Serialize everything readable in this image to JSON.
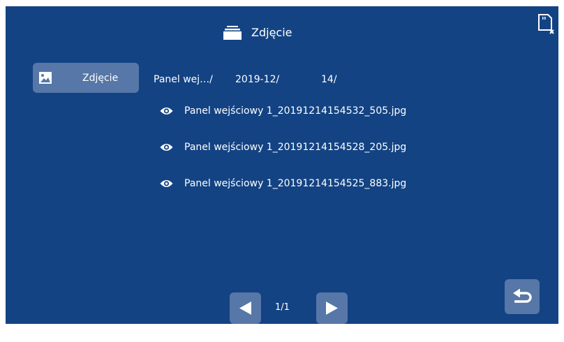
{
  "header": {
    "title": "Zdjęcie",
    "icon": "folder-stack-icon"
  },
  "status": {
    "sd_icon": "sd-card-removed-icon"
  },
  "sidebar": {
    "items": [
      {
        "label": "Zdjęcie",
        "icon": "image-icon",
        "selected": true
      }
    ]
  },
  "breadcrumb": {
    "part1": "Panel wej…/",
    "part2": "2019-12/",
    "part3": "14/"
  },
  "files": [
    {
      "name": "Panel wejściowy 1_20191214154532_505.jpg",
      "icon": "eye-icon"
    },
    {
      "name": "Panel wejściowy 1_20191214154528_205.jpg",
      "icon": "eye-icon"
    },
    {
      "name": "Panel wejściowy 1_20191214154525_883.jpg",
      "icon": "eye-icon"
    }
  ],
  "pager": {
    "indicator": "1/1",
    "prev_icon": "triangle-left-icon",
    "next_icon": "triangle-right-icon"
  },
  "back": {
    "icon": "return-arrow-icon"
  },
  "colors": {
    "background": "#134383",
    "button": "#5677a7",
    "text": "#ffffff"
  }
}
